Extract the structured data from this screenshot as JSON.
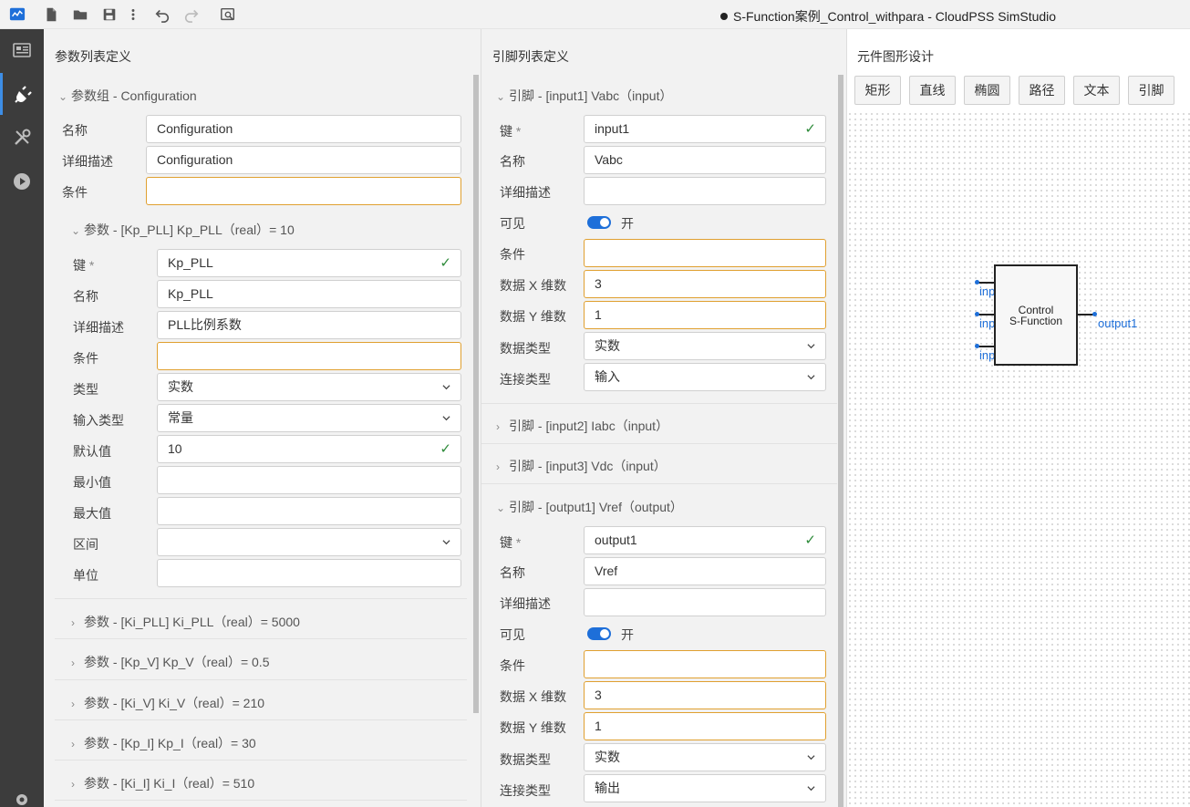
{
  "window": {
    "title": "S-Function案例_Control_withpara - CloudPSS SimStudio",
    "unsaved_dot": "●"
  },
  "toolbar": {
    "icons": [
      "app-logo-icon",
      "new-file-icon",
      "open-folder-icon",
      "save-icon",
      "more-vert-icon",
      "undo-icon",
      "redo-icon",
      "search-preview-icon"
    ]
  },
  "sidebar": {
    "items": [
      "dashboard-icon",
      "plug-icon",
      "tools-icon",
      "play-icon"
    ],
    "bottom": "gear-icon"
  },
  "params_panel": {
    "title": "参数列表定义",
    "group_header": "参数组 - Configuration",
    "group_fields": [
      {
        "label": "名称",
        "value": "Configuration"
      },
      {
        "label": "详细描述",
        "value": "Configuration"
      },
      {
        "label": "条件",
        "value": ""
      }
    ],
    "param_header": "参数 - [Kp_PLL] Kp_PLL（real）= 10",
    "param_fields": [
      {
        "label": "键",
        "value": "Kp_PLL",
        "required": "*"
      },
      {
        "label": "名称",
        "value": "Kp_PLL"
      },
      {
        "label": "详细描述",
        "value": "PLL比例系数"
      },
      {
        "label": "条件",
        "value": ""
      },
      {
        "label": "类型",
        "value": "实数"
      },
      {
        "label": "输入类型",
        "value": "常量"
      },
      {
        "label": "默认值",
        "value": "10"
      },
      {
        "label": "最小值",
        "value": ""
      },
      {
        "label": "最大值",
        "value": ""
      },
      {
        "label": "区间",
        "value": ""
      },
      {
        "label": "单位",
        "value": ""
      }
    ],
    "collapsed_params": [
      "参数 - [Ki_PLL] Ki_PLL（real）= 5000",
      "参数 - [Kp_V] Kp_V（real）= 0.5",
      "参数 - [Ki_V] Ki_V（real）= 210",
      "参数 - [Kp_I] Kp_I（real）= 30",
      "参数 - [Ki_I] Ki_I（real）= 510"
    ]
  },
  "pins_panel": {
    "title": "引脚列表定义",
    "pin1_header": "引脚 - [input1] Vabc（input）",
    "pin1_fields": [
      {
        "label": "键",
        "value": "input1",
        "required": "*"
      },
      {
        "label": "名称",
        "value": "Vabc"
      },
      {
        "label": "详细描述",
        "value": ""
      },
      {
        "label": "可见",
        "value": "开"
      },
      {
        "label": "条件",
        "value": ""
      },
      {
        "label": "数据 X 维数",
        "value": "3"
      },
      {
        "label": "数据 Y 维数",
        "value": "1"
      },
      {
        "label": "数据类型",
        "value": "实数"
      },
      {
        "label": "连接类型",
        "value": "输入"
      }
    ],
    "pin2_header": "引脚 - [input2] Iabc（input）",
    "pin3_header": "引脚 - [input3] Vdc（input）",
    "pin4_header": "引脚 - [output1] Vref（output）",
    "pin4_fields": [
      {
        "label": "键",
        "value": "output1",
        "required": "*"
      },
      {
        "label": "名称",
        "value": "Vref"
      },
      {
        "label": "详细描述",
        "value": ""
      },
      {
        "label": "可见",
        "value": "开"
      },
      {
        "label": "条件",
        "value": ""
      },
      {
        "label": "数据 X 维数",
        "value": "3"
      },
      {
        "label": "数据 Y 维数",
        "value": "1"
      },
      {
        "label": "数据类型",
        "value": "实数"
      },
      {
        "label": "连接类型",
        "value": "输出"
      }
    ]
  },
  "design_panel": {
    "title": "元件图形设计",
    "shape_buttons": [
      "矩形",
      "直线",
      "椭圆",
      "路径",
      "文本",
      "引脚"
    ],
    "block_text_line1": "Control",
    "block_text_line2": "S-Function",
    "pin_labels": [
      "inp",
      "inp",
      "inp",
      "output1"
    ]
  },
  "colors": {
    "accent": "#1e6fd9",
    "warn_border": "#e0a030",
    "check": "#2e8b3a",
    "sidebar": "#3c3c3c"
  }
}
